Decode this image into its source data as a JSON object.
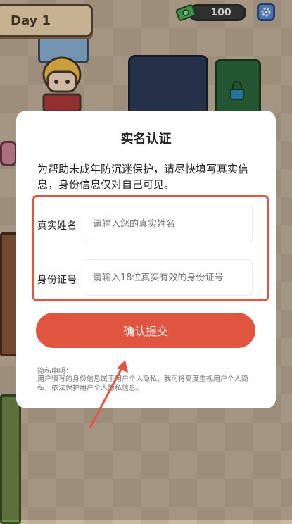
{
  "hud": {
    "day_label": "Day 1",
    "money_value": "100",
    "money_icon": "cash-icon",
    "settings_icon": "gear-icon"
  },
  "dialog": {
    "title": "实名认证",
    "description": "为帮助未成年防沉迷保护，请尽快填写真实信息，身份信息仅对自己可见。",
    "fields": {
      "name": {
        "label": "真实姓名",
        "placeholder": "请输入您的真实姓名"
      },
      "id_number": {
        "label": "身份证号",
        "placeholder": "请输入18位真实有效的身份证号"
      }
    },
    "submit_label": "确认提交",
    "privacy_title": "隐私申明：",
    "privacy_text": "用户填写的身份信息属于用户个人隐私，我司将高度重视用户个人隐私，依法保护用户个人隐私信息。"
  },
  "colors": {
    "accent": "#e0553f",
    "dialog_bg": "#ffffff",
    "highlight_frame": "#e0553f"
  }
}
